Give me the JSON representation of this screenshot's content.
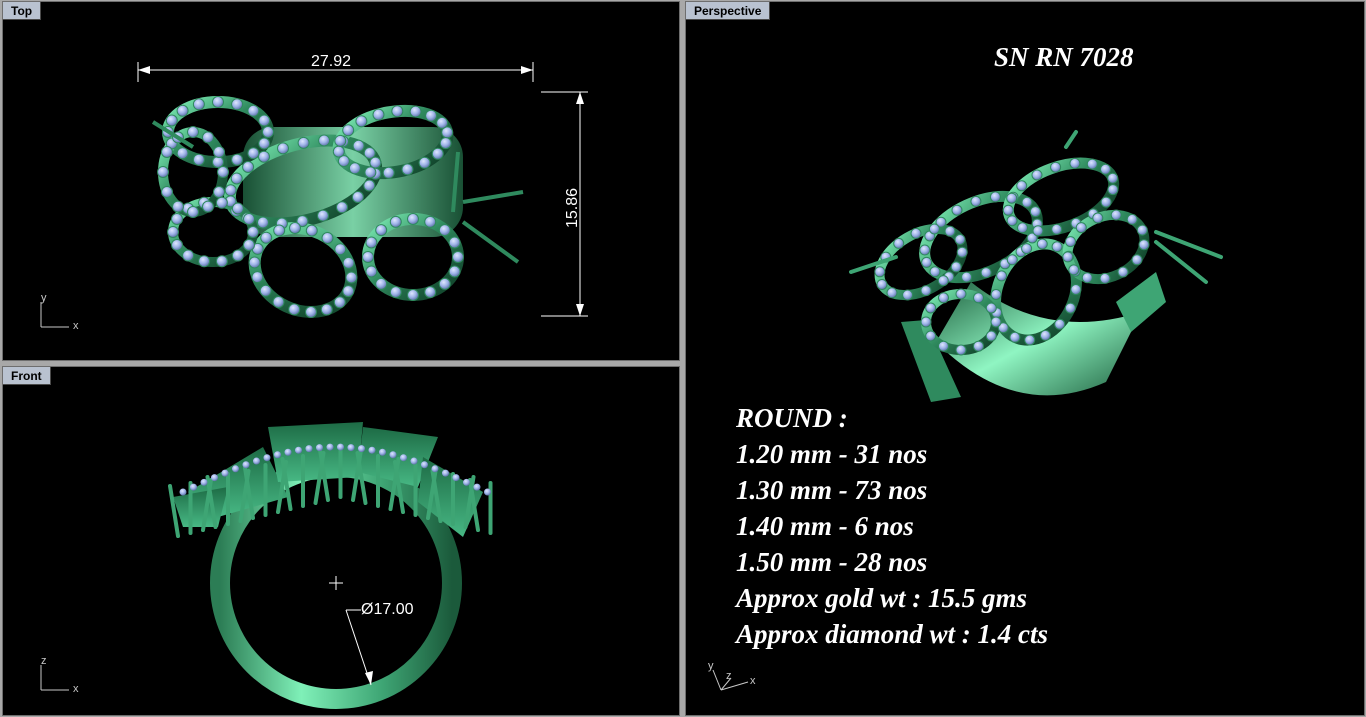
{
  "viewports": {
    "top": {
      "label": "Top",
      "width_dimension": "27.92",
      "height_dimension": "15.86",
      "axis_v": "y",
      "axis_h": "x"
    },
    "front": {
      "label": "Front",
      "diameter_dimension": "Ø17.00",
      "axis_v": "z",
      "axis_h": "x"
    },
    "perspective": {
      "label": "Perspective",
      "title": "SN RN 7028",
      "specs": [
        "ROUND :",
        "1.20 mm - 31 nos",
        "1.30 mm - 73 nos",
        "1.40 mm - 6 nos",
        "1.50 mm - 28 nos",
        "Approx gold wt : 15.5 gms",
        "Approx diamond wt : 1.4 cts"
      ],
      "axis_v": "y",
      "axis_h": "x",
      "axis_d": "z"
    }
  },
  "colors": {
    "background": "#000000",
    "metal": "#2f8a5e",
    "metal_light": "#6fe0a8",
    "stone": "#9fb4e8",
    "tab": "#b9c2d0"
  }
}
